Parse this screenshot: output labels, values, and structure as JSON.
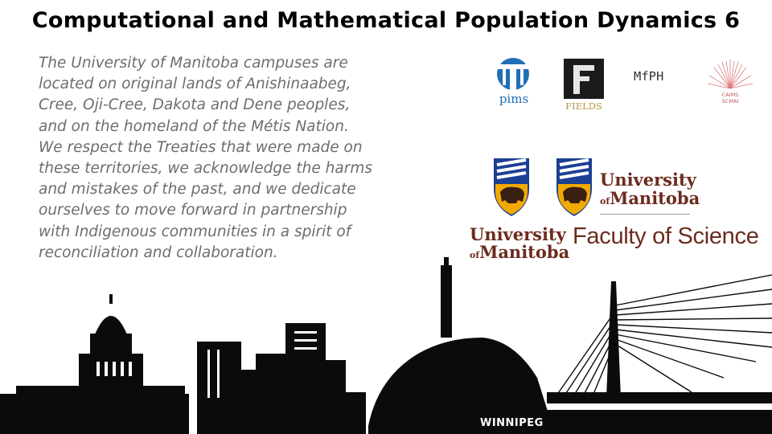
{
  "title": "Computational and Mathematical Population Dynamics 6",
  "acknowledgement": "The University of Manitoba campuses are located on original lands of Anishinaabeg, Cree, Oji-Cree, Dakota and Dene peoples, and on the homeland of the Métis Nation. We respect the Treaties that were made on these territories, we acknowledge the harms and mistakes of the past, and we dedicate ourselves to move forward in partnership with Indigenous communities in a spirit of reconciliation and collaboration.",
  "logos": {
    "pims": "pims",
    "fields": "FIELDS",
    "mfph": "MfPH",
    "caims_line1": "CAIMS",
    "caims_line2": "SCMAI",
    "um_university": "University",
    "um_of": "of",
    "um_manitoba": "Manitoba",
    "faculty": "Faculty of Science"
  },
  "skyline_label": "WINNIPEG",
  "colors": {
    "title": "#000000",
    "text": "#6d6d6d",
    "um_brown": "#6c2b1d",
    "um_blue": "#1c3f93",
    "um_gold": "#f2a900",
    "pims_blue": "#1f6fb5",
    "fields_gold": "#b59a45",
    "caims_red": "#c0392b"
  }
}
